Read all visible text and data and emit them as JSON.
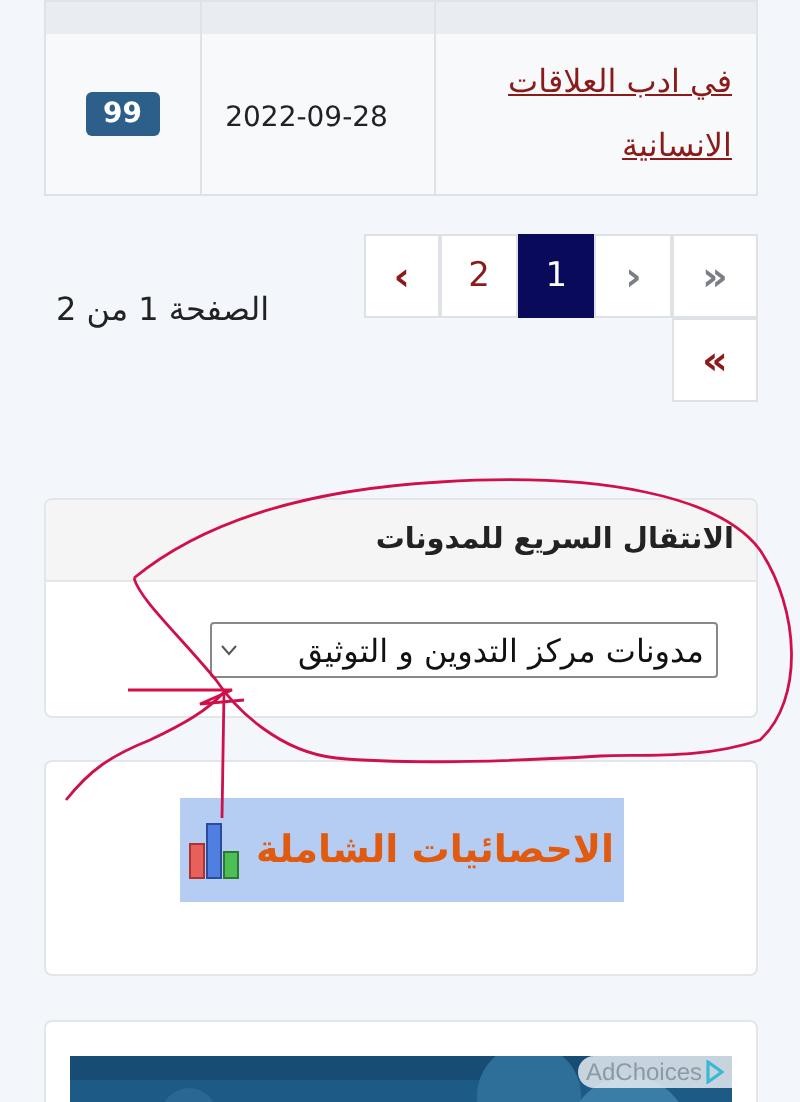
{
  "table": {
    "rows": [
      {
        "title": "في ادب العلاقات الانسانية",
        "date": "2022-09-28",
        "count": "99"
      }
    ]
  },
  "pagination": {
    "items": [
      {
        "label": "»",
        "selected": false,
        "disabled": true
      },
      {
        "label": "›",
        "selected": false,
        "disabled": true
      },
      {
        "label": "1",
        "selected": true,
        "disabled": false
      },
      {
        "label": "2",
        "selected": false,
        "disabled": false
      },
      {
        "label": "‹",
        "selected": false,
        "disabled": false
      },
      {
        "label": "«",
        "selected": false,
        "disabled": false
      }
    ],
    "status": "الصفحة 1 من 2"
  },
  "quick_jump": {
    "title": "الانتقال السريع للمدونات",
    "select": {
      "value": "مدونات مركز التدوين و التوثيق"
    }
  },
  "banner": {
    "text": "الاحصائيات الشاملة"
  },
  "ad": {
    "kind": "picture",
    "label": "AdChoices"
  },
  "markup": {
    "circle": true,
    "arrow": true
  }
}
